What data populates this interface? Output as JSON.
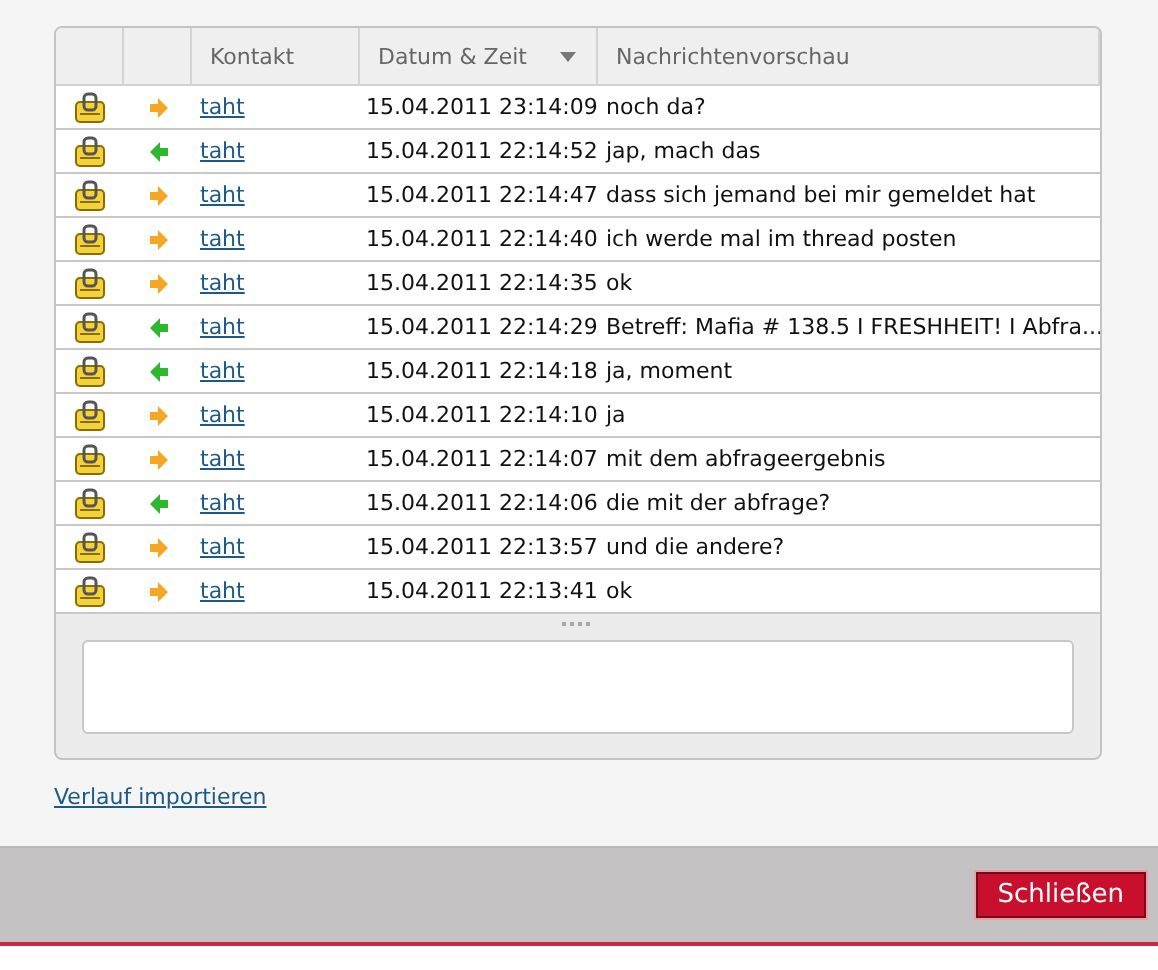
{
  "table": {
    "columns": [
      {
        "label": "Kontakt",
        "sorted": false
      },
      {
        "label": "Datum & Zeit",
        "sorted": true
      },
      {
        "label": "Nachrichtenvorschau",
        "sorted": false
      }
    ],
    "rows": [
      {
        "kind": "outgoing",
        "contact": "taht",
        "time": "15.04.2011 23:14:09",
        "preview": "noch da?"
      },
      {
        "kind": "incoming",
        "contact": "taht",
        "time": "15.04.2011 22:14:52",
        "preview": "jap, mach das"
      },
      {
        "kind": "outgoing",
        "contact": "taht",
        "time": "15.04.2011 22:14:47",
        "preview": "dass sich jemand bei mir gemeldet hat"
      },
      {
        "kind": "outgoing",
        "contact": "taht",
        "time": "15.04.2011 22:14:40",
        "preview": "ich werde mal im thread posten"
      },
      {
        "kind": "outgoing",
        "contact": "taht",
        "time": "15.04.2011 22:14:35",
        "preview": "ok"
      },
      {
        "kind": "incoming",
        "contact": "taht",
        "time": "15.04.2011 22:14:29",
        "preview": "Betreff: Mafia # 138.5 I FRESHHEIT! I Abfra..."
      },
      {
        "kind": "incoming",
        "contact": "taht",
        "time": "15.04.2011 22:14:18",
        "preview": "ja, moment"
      },
      {
        "kind": "outgoing",
        "contact": "taht",
        "time": "15.04.2011 22:14:10",
        "preview": "ja"
      },
      {
        "kind": "outgoing",
        "contact": "taht",
        "time": "15.04.2011 22:14:07",
        "preview": "mit dem abfrageergebnis"
      },
      {
        "kind": "incoming",
        "contact": "taht",
        "time": "15.04.2011 22:14:06",
        "preview": "die mit der abfrage?"
      },
      {
        "kind": "outgoing",
        "contact": "taht",
        "time": "15.04.2011 22:13:57",
        "preview": "und die andere?"
      },
      {
        "kind": "outgoing",
        "contact": "taht",
        "time": "15.04.2011 22:13:41",
        "preview": "ok"
      }
    ]
  },
  "import_link": "Verlauf importieren",
  "close_button": "Schließen"
}
